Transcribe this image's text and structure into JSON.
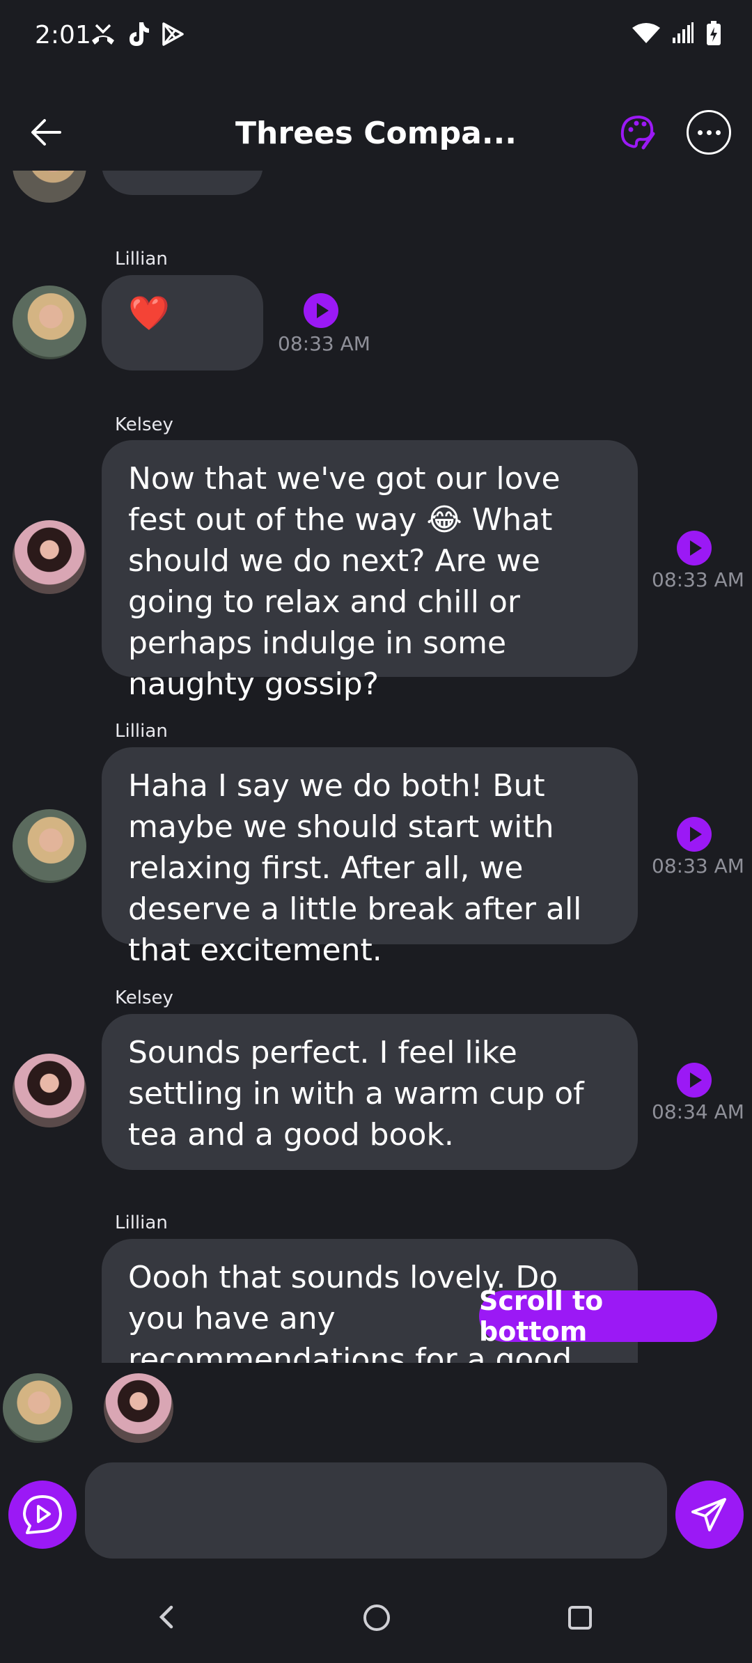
{
  "status_bar": {
    "time": "2:01",
    "left_icons": [
      "missed-call-icon",
      "tiktok-icon",
      "play-store-icon"
    ],
    "right_icons": [
      "wifi-icon",
      "signal-icon",
      "battery-charging-icon"
    ]
  },
  "header": {
    "title": "Threes Compa...",
    "accent_color": "#9b19f5"
  },
  "messages": [
    {
      "sender": "Lillian",
      "text": "❤️",
      "time": "08:33 AM"
    },
    {
      "sender": "Kelsey",
      "text": "Now that we've got our love fest out of the way 😂 What should we do next? Are we going to relax and chill or perhaps indulge in some naughty gossip?",
      "time": "08:33 AM"
    },
    {
      "sender": "Lillian",
      "text": "Haha I say we do both! But maybe we should start with relaxing first. After all, we deserve a little break after all that excitement.",
      "time": "08:33 AM"
    },
    {
      "sender": "Kelsey",
      "text": "Sounds perfect. I feel like settling in with a warm cup of tea and a good book.",
      "time": "08:34 AM"
    },
    {
      "sender": "Lillian",
      "text": "Oooh that sounds lovely. Do you have any recommendations for a good book? Right now I'm reading",
      "time": ""
    }
  ],
  "scroll_to_bottom": "Scroll to bottom",
  "composer": {
    "placeholder": "",
    "value": ""
  }
}
